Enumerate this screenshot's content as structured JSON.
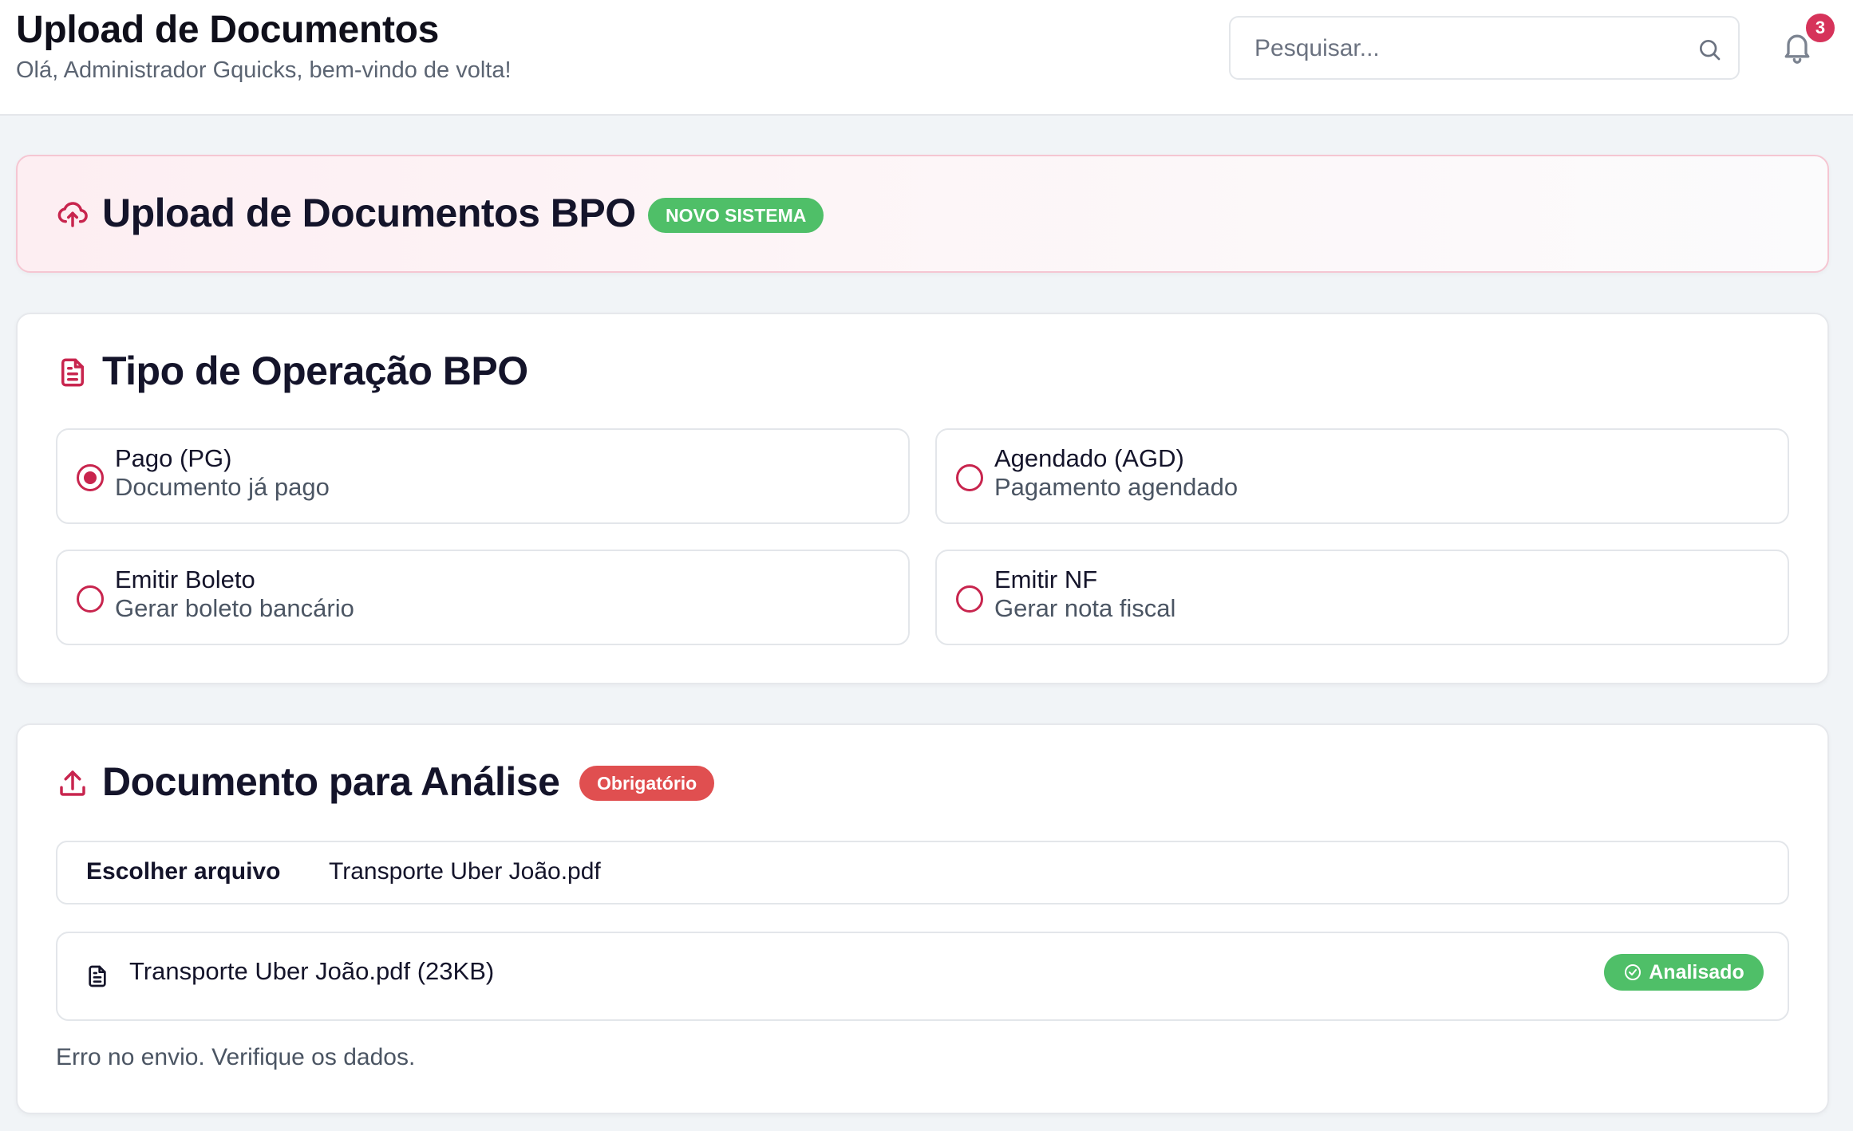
{
  "header": {
    "title": "Upload de Documentos",
    "subtitle": "Olá, Administrador Gquicks, bem-vindo de volta!",
    "search_placeholder": "Pesquisar...",
    "notification_count": "3"
  },
  "hero": {
    "title": "Upload de Documentos BPO",
    "badge": "NOVO SISTEMA"
  },
  "operation": {
    "title": "Tipo de Operação BPO",
    "options": [
      {
        "title": "Pago (PG)",
        "description": "Documento já pago",
        "selected": true
      },
      {
        "title": "Agendado (AGD)",
        "description": "Pagamento agendado",
        "selected": false
      },
      {
        "title": "Emitir Boleto",
        "description": "Gerar boleto bancário",
        "selected": false
      },
      {
        "title": "Emitir NF",
        "description": "Gerar nota fiscal",
        "selected": false
      }
    ]
  },
  "document": {
    "title": "Documento para Análise",
    "required_badge": "Obrigatório",
    "file_button": "Escolher arquivo",
    "file_name": "Transporte Uber João.pdf",
    "uploaded_file": "Transporte Uber João.pdf (23KB)",
    "status": "Analisado",
    "error_message": "Erro no envio. Verifique os dados."
  },
  "colors": {
    "accent": "#c8254e",
    "success": "#4fbf68",
    "danger": "#e04f50",
    "badge": "#d6335a"
  },
  "icons": {
    "search": "search-icon",
    "bell": "bell-icon",
    "cloud_upload": "cloud-upload-icon",
    "document": "document-icon",
    "upload": "upload-icon",
    "check_circle": "check-circle-icon"
  }
}
